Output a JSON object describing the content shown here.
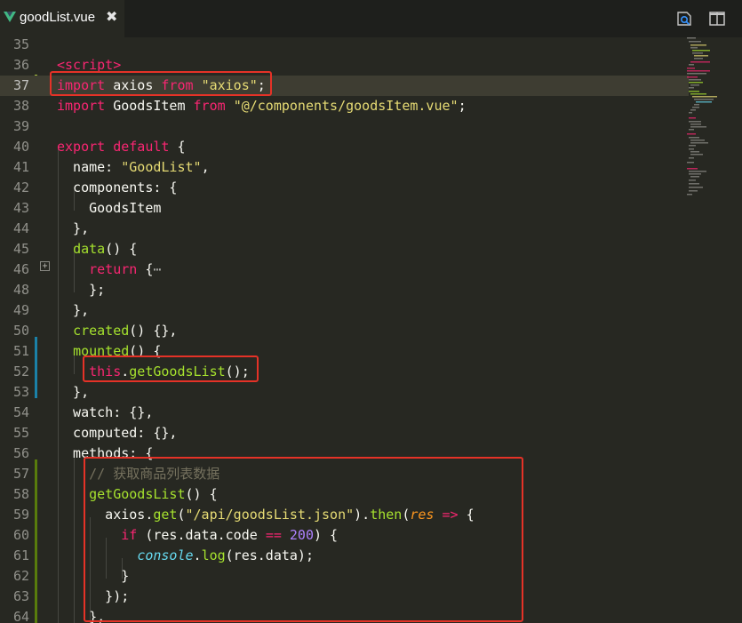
{
  "tab": {
    "filename": "goodList.vue",
    "close_glyph": "✖"
  },
  "toolbar": {
    "icons": [
      "open-preview-icon",
      "split-editor-icon"
    ]
  },
  "colors": {
    "background": "#272822",
    "tabbar": "#1e1f1c",
    "highlight_box": "#e53227",
    "vue_green": "#41b883",
    "vue_dark": "#35495e"
  },
  "editor": {
    "active_line": 37,
    "lines": [
      {
        "n": "35",
        "t": []
      },
      {
        "n": "36",
        "t": [
          [
            "tag",
            "<script"
          ],
          [
            "tag",
            ">"
          ]
        ]
      },
      {
        "n": "37",
        "t": [
          [
            "kw",
            "import"
          ],
          [
            "",
            " axios "
          ],
          [
            "kw",
            "from"
          ],
          [
            "",
            " "
          ],
          [
            "str",
            "\"axios\""
          ],
          [
            "",
            ";"
          ]
        ]
      },
      {
        "n": "38",
        "t": [
          [
            "kw",
            "import"
          ],
          [
            "",
            " GoodsItem "
          ],
          [
            "kw",
            "from"
          ],
          [
            "",
            " "
          ],
          [
            "str",
            "\"@/components/goodsItem.vue\""
          ],
          [
            "",
            ";"
          ]
        ]
      },
      {
        "n": "39",
        "t": []
      },
      {
        "n": "40",
        "t": [
          [
            "kw",
            "export"
          ],
          [
            "",
            " "
          ],
          [
            "kw",
            "default"
          ],
          [
            "",
            " {"
          ]
        ]
      },
      {
        "n": "41",
        "t": [
          [
            "",
            "  name: "
          ],
          [
            "str",
            "\"GoodList\""
          ],
          [
            "",
            ","
          ]
        ]
      },
      {
        "n": "42",
        "t": [
          [
            "",
            "  components: {"
          ]
        ]
      },
      {
        "n": "43",
        "t": [
          [
            "",
            "    GoodsItem"
          ]
        ]
      },
      {
        "n": "44",
        "t": [
          [
            "",
            "  },"
          ]
        ]
      },
      {
        "n": "45",
        "t": [
          [
            "",
            "  "
          ],
          [
            "fn",
            "data"
          ],
          [
            "",
            "() {"
          ]
        ]
      },
      {
        "n": "46",
        "t": [
          [
            "",
            "    "
          ],
          [
            "kw",
            "return"
          ],
          [
            "",
            " {"
          ],
          [
            "fold",
            "⋯"
          ]
        ]
      },
      {
        "n": "48",
        "t": [
          [
            "",
            "    };"
          ]
        ]
      },
      {
        "n": "49",
        "t": [
          [
            "",
            "  },"
          ]
        ]
      },
      {
        "n": "50",
        "t": [
          [
            "",
            "  "
          ],
          [
            "fn",
            "created"
          ],
          [
            "",
            "() {},"
          ]
        ]
      },
      {
        "n": "51",
        "t": [
          [
            "",
            "  "
          ],
          [
            "fn",
            "mounted"
          ],
          [
            "",
            "() {"
          ]
        ]
      },
      {
        "n": "52",
        "t": [
          [
            "",
            "    "
          ],
          [
            "kw",
            "this"
          ],
          [
            "",
            "."
          ],
          [
            "fn",
            "getGoodsList"
          ],
          [
            "",
            "();"
          ]
        ]
      },
      {
        "n": "53",
        "t": [
          [
            "",
            "  },"
          ]
        ]
      },
      {
        "n": "54",
        "t": [
          [
            "",
            "  watch: {},"
          ]
        ]
      },
      {
        "n": "55",
        "t": [
          [
            "",
            "  computed: {},"
          ]
        ]
      },
      {
        "n": "56",
        "t": [
          [
            "",
            "  methods: {"
          ]
        ]
      },
      {
        "n": "57",
        "t": [
          [
            "",
            "    "
          ],
          [
            "comment",
            "// 获取商品列表数据"
          ]
        ]
      },
      {
        "n": "58",
        "t": [
          [
            "",
            "    "
          ],
          [
            "fn",
            "getGoodsList"
          ],
          [
            "",
            "() {"
          ]
        ]
      },
      {
        "n": "59",
        "t": [
          [
            "",
            "      axios."
          ],
          [
            "fn",
            "get"
          ],
          [
            "",
            "("
          ],
          [
            "str",
            "\"/api/goodsList.json\""
          ],
          [
            "",
            ")."
          ],
          [
            "fn",
            "then"
          ],
          [
            "",
            "("
          ],
          [
            "param",
            "res"
          ],
          [
            "",
            " "
          ],
          [
            "kw",
            "=>"
          ],
          [
            "",
            " {"
          ]
        ]
      },
      {
        "n": "60",
        "t": [
          [
            "",
            "        "
          ],
          [
            "kw",
            "if"
          ],
          [
            "",
            " (res.data.code "
          ],
          [
            "kw",
            "=="
          ],
          [
            "",
            " "
          ],
          [
            "num",
            "200"
          ],
          [
            "",
            ") {"
          ]
        ]
      },
      {
        "n": "61",
        "t": [
          [
            "",
            "          "
          ],
          [
            "sup",
            "console"
          ],
          [
            "",
            "."
          ],
          [
            "fn",
            "log"
          ],
          [
            "",
            "(res.data);"
          ]
        ]
      },
      {
        "n": "62",
        "t": [
          [
            "",
            "        }"
          ]
        ]
      },
      {
        "n": "63",
        "t": [
          [
            "",
            "      });"
          ]
        ]
      },
      {
        "n": "64",
        "t": [
          [
            "",
            "    },"
          ]
        ]
      }
    ]
  }
}
